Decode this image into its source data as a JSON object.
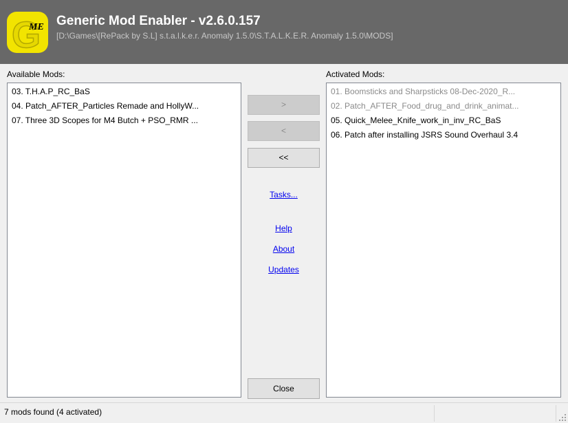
{
  "app": {
    "title": "Generic Mod Enabler - v2.6.0.157",
    "path": "[D:\\Games\\[RePack by S.L] s.t.a.l.k.e.r. Anomaly 1.5.0\\S.T.A.L.K.E.R. Anomaly 1.5.0\\MODS]",
    "logo_letters": "GME",
    "colors": {
      "header": "#686868",
      "logo_yellow": "#f2e400",
      "link": "#0000ee"
    }
  },
  "available": {
    "label": "Available Mods:",
    "items": [
      {
        "text": "03. T.H.A.P_RC_BaS"
      },
      {
        "text": "04. Patch_AFTER_Particles Remade and HollyW..."
      },
      {
        "text": "07. Three 3D Scopes for M4 Butch + PSO_RMR ..."
      }
    ]
  },
  "activated": {
    "label": "Activated Mods:",
    "items": [
      {
        "text": "01. Boomsticks and Sharpsticks 08-Dec-2020_R..."
      },
      {
        "text": "02. Patch_AFTER_Food_drug_and_drink_animat..."
      },
      {
        "text": "05. Quick_Melee_Knife_work_in_inv_RC_BaS"
      },
      {
        "text": "06. Patch after installing JSRS Sound Overhaul 3.4"
      }
    ]
  },
  "buttons": {
    "activate": ">",
    "deactivate": "<",
    "deactivate_all": "<<",
    "close": "Close"
  },
  "links": {
    "tasks": "Tasks...",
    "help": "Help",
    "about": "About",
    "updates": "Updates"
  },
  "status": {
    "text": "7 mods found (4 activated)"
  }
}
